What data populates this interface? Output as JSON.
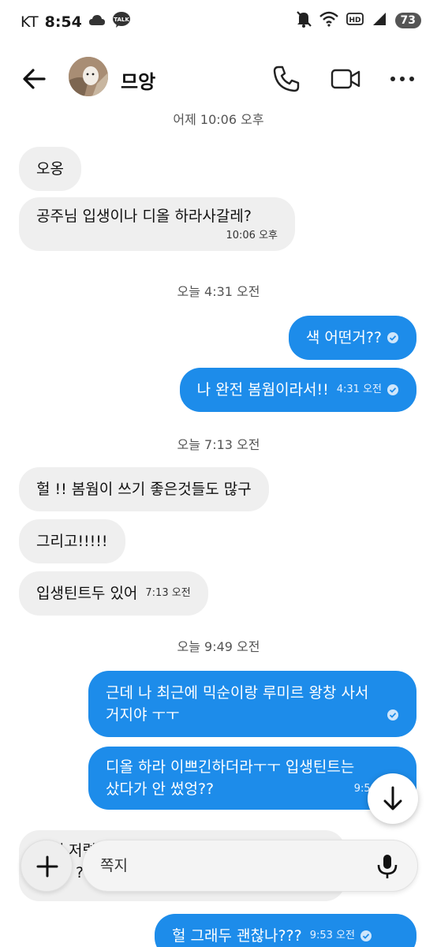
{
  "status_bar": {
    "carrier": "KT",
    "time": "8:54",
    "talk_badge": "TALK",
    "battery": "73",
    "hd": "HD"
  },
  "header": {
    "contact_name": "므앙",
    "avatar": "avatar-photo"
  },
  "messages": {
    "ts_top": "어제 10:06 오후",
    "m1": "오옹",
    "m2": "공주님 입생이나 디올 하라사갈레?",
    "m2_time": "10:06 오후",
    "ts2": "오늘 4:31 오전",
    "m3": "색 어떤거??",
    "m4": "나 완전 봄웜이라서!!",
    "m4_time": "4:31 오전",
    "ts3": "오늘 7:13 오전",
    "m5": "헐 !! 봄웜이 쓰기 좋은것들도 많구",
    "m6": "그리고!!!!!",
    "m7": "입생틴트두 있어",
    "m7_time": "7:13 오전",
    "ts4": "오늘 9:49 오전",
    "m8_line1": "근데 나 최근에 믹순이랑 루미르 왕창 사서",
    "m8_line2": "거지야 ㅜㅜ",
    "m9_line1": "디올 하라 이쁘긴하더라ㅜㅜ 입생틴트는",
    "m9_line2": "샀다가 안 썼엉??",
    "m9_time": "9:50 오전",
    "m10_partial": "되게 저렴한데 너무좋대 하나만 오더한",
    "m10_partial2": "?",
    "m11": "헐 그래두 괜찮나???",
    "m11_time": "9:53 오전"
  },
  "composer": {
    "placeholder": "쪽지"
  },
  "colors": {
    "outgoing": "#1d8cea",
    "incoming": "#efefef"
  }
}
